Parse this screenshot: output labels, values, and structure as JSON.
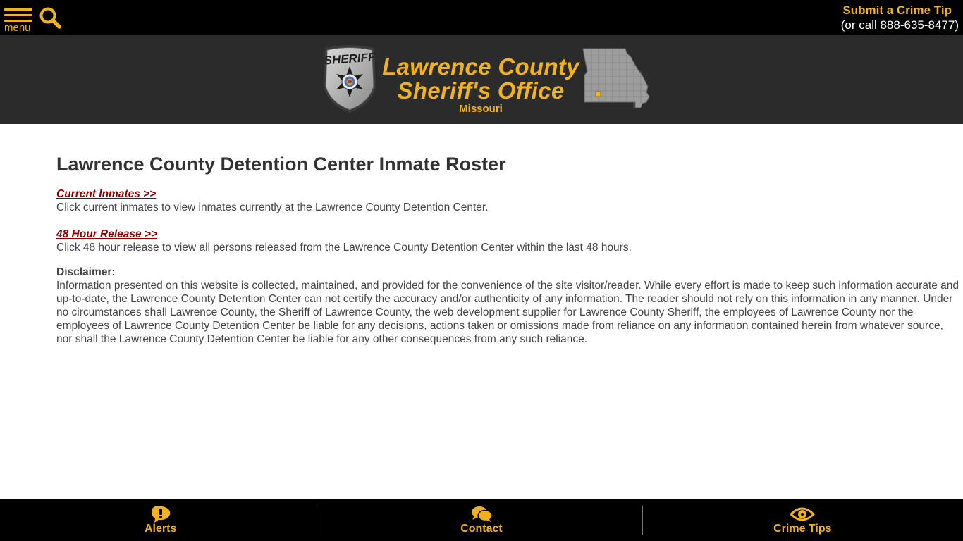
{
  "header": {
    "menu_label": "menu",
    "crime_tip_link": "Submit a Crime Tip",
    "crime_tip_phone": "(or call 888-635-8477)",
    "badge_text": "SHERIFF"
  },
  "banner": {
    "title_line1": "Lawrence County",
    "title_line2": "Sheriff's Office",
    "state": "Missouri"
  },
  "main": {
    "page_title": "Lawrence County Detention Center Inmate Roster",
    "current_inmates_link": "Current Inmates >>",
    "current_inmates_desc": "Click current inmates to view inmates currently at the Lawrence County Detention Center.",
    "release_link": "48 Hour Release >>",
    "release_desc": "Click 48 hour release to view all persons released from the Lawrence County Detention Center within the last 48 hours.",
    "disclaimer_heading": "Disclaimer:",
    "disclaimer_text": "Information presented on this website is collected, maintained, and provided for the convenience of the site visitor/reader. While every effort is made to keep such information accurate and up-to-date, the Lawrence County Detention Center can not certify the accuracy and/or authenticity of any information. The reader should not rely on this information in any manner.  Under no circumstances shall Lawrence County, the Sheriff of Lawrence County, the web development supplier for Lawrence County Sheriff, the employees of Lawrence County nor the employees of Lawrence County Detention Center be liable for any decisions, actions taken or omissions made from reliance on any information contained herein from whatever source, nor shall the Lawrence County Detention Center be liable for any other consequences from any such reliance."
  },
  "bottom_nav": [
    {
      "label": "Alerts",
      "icon": "exclamation-bubble-icon"
    },
    {
      "label": "Contact",
      "icon": "chat-bubbles-icon"
    },
    {
      "label": "Crime Tips",
      "icon": "eye-icon"
    }
  ],
  "colors": {
    "accent": "#f2b21b",
    "top_bar": "#000000",
    "banner": "#2b2b2b",
    "link": "#8b0000",
    "text": "#444444"
  }
}
